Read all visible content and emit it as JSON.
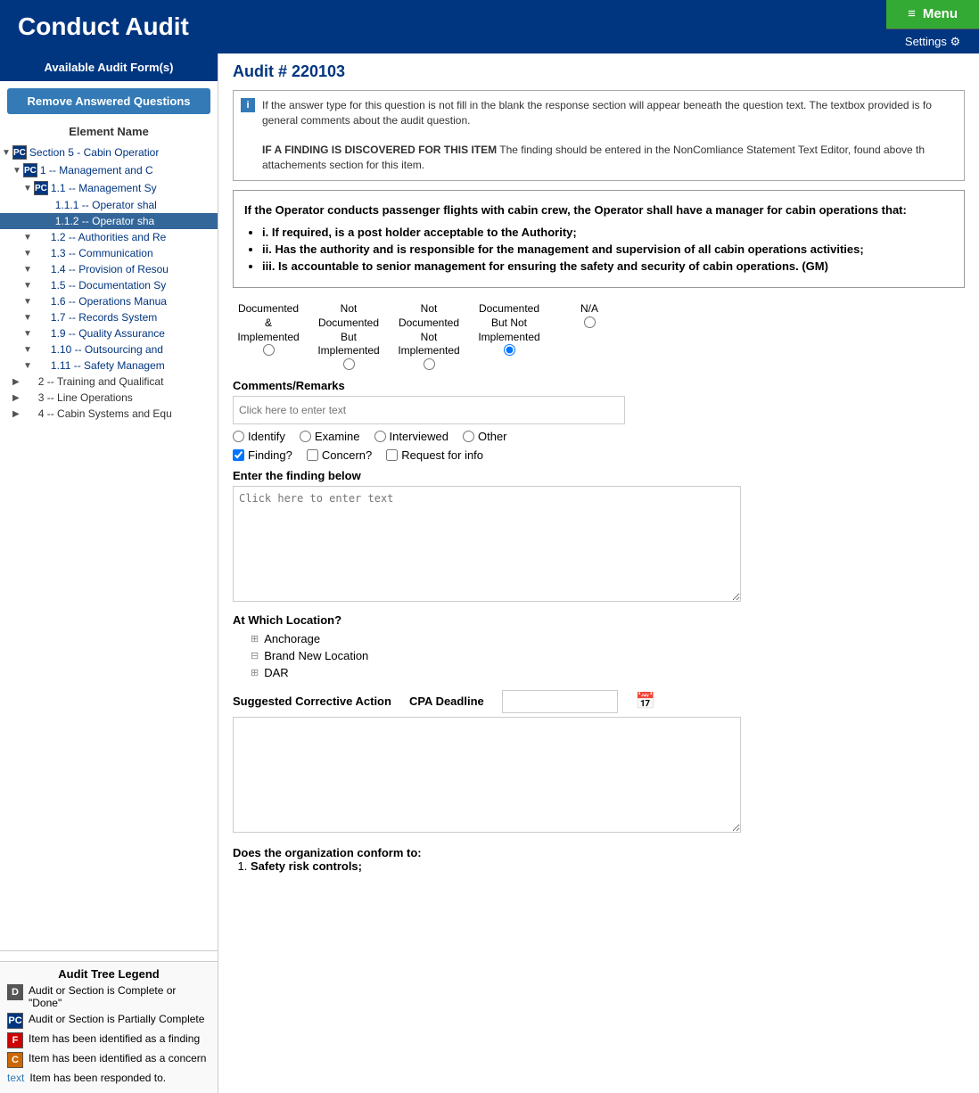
{
  "header": {
    "title": "Conduct Audit",
    "menu_label": "Menu",
    "settings_label": "Settings ⚙"
  },
  "sidebar": {
    "available_forms": "Available Audit Form(s)",
    "remove_btn": "Remove Answered Questions",
    "element_name": "Element Name",
    "tree": [
      {
        "id": "section5",
        "level": 0,
        "toggle": "▼",
        "badge": "PC",
        "text": "Section 5 - Cabin Operatior",
        "selected": false,
        "link": true
      },
      {
        "id": "mgmt",
        "level": 1,
        "toggle": "▼",
        "badge": "PC",
        "text": "1 -- Management and C",
        "selected": false,
        "link": true
      },
      {
        "id": "mgmt-sy",
        "level": 2,
        "toggle": "▼",
        "badge": "PC",
        "text": "1.1 -- Management Sy",
        "selected": false,
        "link": true
      },
      {
        "id": "op-shall1",
        "level": 3,
        "toggle": "",
        "badge": "",
        "text": "1.1.1 -- Operator shal",
        "selected": false,
        "link": true
      },
      {
        "id": "op-shall2",
        "level": 3,
        "toggle": "",
        "badge": "",
        "text": "1.1.2 -- Operator sha",
        "selected": true,
        "link": true
      },
      {
        "id": "auth-re",
        "level": 2,
        "toggle": "▼",
        "badge": "",
        "text": "1.2 -- Authorities and Re",
        "selected": false,
        "link": true
      },
      {
        "id": "comm",
        "level": 2,
        "toggle": "▼",
        "badge": "",
        "text": "1.3 -- Communication",
        "selected": false,
        "link": true
      },
      {
        "id": "prov-res",
        "level": 2,
        "toggle": "▼",
        "badge": "",
        "text": "1.4 -- Provision of Resou",
        "selected": false,
        "link": true
      },
      {
        "id": "doc-sy",
        "level": 2,
        "toggle": "▼",
        "badge": "",
        "text": "1.5 -- Documentation Sy",
        "selected": false,
        "link": true
      },
      {
        "id": "ops-man",
        "level": 2,
        "toggle": "▼",
        "badge": "",
        "text": "1.6 -- Operations Manua",
        "selected": false,
        "link": true
      },
      {
        "id": "rec-sys",
        "level": 2,
        "toggle": "▼",
        "badge": "",
        "text": "1.7 -- Records System",
        "selected": false,
        "link": true
      },
      {
        "id": "qa",
        "level": 2,
        "toggle": "▼",
        "badge": "",
        "text": "1.9 -- Quality Assurance",
        "selected": false,
        "link": true
      },
      {
        "id": "outsource",
        "level": 2,
        "toggle": "▼",
        "badge": "",
        "text": "1.10 -- Outsourcing and",
        "selected": false,
        "link": true
      },
      {
        "id": "safety-mgmt",
        "level": 2,
        "toggle": "▼",
        "badge": "",
        "text": "1.11 -- Safety Managem",
        "selected": false,
        "link": true
      },
      {
        "id": "training",
        "level": 1,
        "toggle": "▶",
        "badge": "",
        "text": "2 -- Training and Qualificat",
        "selected": false,
        "link": false
      },
      {
        "id": "line-ops",
        "level": 1,
        "toggle": "▶",
        "badge": "",
        "text": "3 -- Line Operations",
        "selected": false,
        "link": false
      },
      {
        "id": "cabin-sys",
        "level": 1,
        "toggle": "▶",
        "badge": "",
        "text": "4 -- Cabin Systems and Equ",
        "selected": false,
        "link": false
      }
    ],
    "legend": {
      "title": "Audit Tree Legend",
      "items": [
        {
          "badge": "D",
          "badge_class": "badge-d",
          "text": "Audit or Section is Complete or \"Done\""
        },
        {
          "badge": "PC",
          "badge_class": "badge-pc",
          "text": "Audit or Section is Partially Complete"
        },
        {
          "badge": "F",
          "badge_class": "badge-f",
          "text": "Item has been identified as a finding"
        },
        {
          "badge": "C",
          "badge_class": "badge-c",
          "text": "Item has been identified as a concern"
        },
        {
          "badge": "text",
          "badge_class": "",
          "text": "Item has been responded to.",
          "is_text": true
        }
      ]
    }
  },
  "main": {
    "audit_number": "Audit # 220103",
    "info_box": {
      "text1": "If the answer type for this question is not fill in the blank the response section will appear beneath the question text. The textbox provided is fo general comments about the audit question.",
      "finding_label": "IF A FINDING IS DISCOVERED FOR THIS ITEM",
      "finding_text": " The finding should be entered in the NonComliance Statement Text Editor, found above th attachements section for this item."
    },
    "question": {
      "text": "If the Operator conducts passenger flights with cabin crew, the Operator shall have a manager for cabin operations that:",
      "bullets": [
        "i. If required, is a post holder acceptable to the Authority;",
        "ii. Has the authority and is responsible for the management and supervision of all cabin operations activities;",
        "iii. Is accountable to senior management for ensuring the safety and security of cabin operations. (GM)"
      ]
    },
    "radio_options": [
      {
        "id": "r1",
        "label": "Documented\n&\nImplemented",
        "checked": false
      },
      {
        "id": "r2",
        "label": "Not\nDocumented\nBut\nImplemented",
        "checked": false
      },
      {
        "id": "r3",
        "label": "Not\nDocumented\nNot\nImplemented",
        "checked": false
      },
      {
        "id": "r4",
        "label": "Documented\nBut Not\nImplemented",
        "checked": true
      },
      {
        "id": "r5",
        "label": "N/A",
        "checked": false
      }
    ],
    "comments_label": "Comments/Remarks",
    "comments_placeholder": "Click here to enter text",
    "audit_methods": {
      "identify": "Identify",
      "examine": "Examine",
      "interviewed": "Interviewed",
      "other": "Other"
    },
    "checkboxes": {
      "finding": "Finding?",
      "concern": "Concern?",
      "request_info": "Request for info",
      "finding_checked": true,
      "concern_checked": false,
      "request_checked": false
    },
    "finding_label": "Enter the finding below",
    "finding_placeholder": "Click here to enter text",
    "location_label": "At Which Location?",
    "locations": [
      {
        "name": "Anchorage",
        "icon": "⊞"
      },
      {
        "name": "Brand New Location",
        "icon": "⊟"
      },
      {
        "name": "DAR",
        "icon": "⊞"
      }
    ],
    "corrective_label": "Suggested Corrective Action",
    "cpa_label": "CPA Deadline",
    "conform_label": "Does the organization conform to:",
    "conform_items": [
      "Safety risk controls;"
    ]
  }
}
